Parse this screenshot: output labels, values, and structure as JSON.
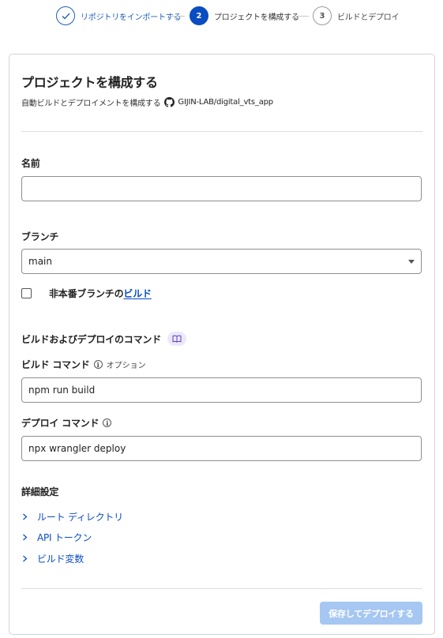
{
  "stepper": {
    "steps": [
      {
        "number": "✓",
        "label": "リポジトリをインポートする",
        "state": "done"
      },
      {
        "number": "2",
        "label": "プロジェクトを構成する",
        "state": "current"
      },
      {
        "number": "3",
        "label": "ビルドとデプロイ",
        "state": "todo"
      }
    ]
  },
  "card": {
    "title": "プロジェクトを構成する",
    "subtitle": "自動ビルドとデプロイメントを構成する",
    "repo": "GIJIN-LAB/digital_vts_app",
    "repo_icon": "github-icon"
  },
  "form": {
    "name_label": "名前",
    "name_value": "",
    "branch_label": "ブランチ",
    "branch_value": "main",
    "nonprod_checkbox_label": "非本番ブランチの",
    "nonprod_checkbox_link": "ビルド",
    "nonprod_checked": false,
    "commands_section_title": "ビルドおよびデプロイのコマンド",
    "commands_section_icon": "book-icon",
    "build_command_label": "ビルド コマンド",
    "build_command_optional": "オプション",
    "build_command_value": "npm run build",
    "deploy_command_label": "デプロイ コマンド",
    "deploy_command_value": "npx wrangler deploy"
  },
  "advanced": {
    "title": "詳細設定",
    "items": [
      {
        "label": "ルート ディレクトリ"
      },
      {
        "label": "API トークン"
      },
      {
        "label": "ビルド変数"
      }
    ]
  },
  "actions": {
    "submit_label": "保存してデプロイする",
    "submit_enabled": false
  },
  "colors": {
    "accent": "#0a4cc2",
    "button_disabled": "#a6c7f2",
    "badge_bg": "#ece8fb"
  }
}
